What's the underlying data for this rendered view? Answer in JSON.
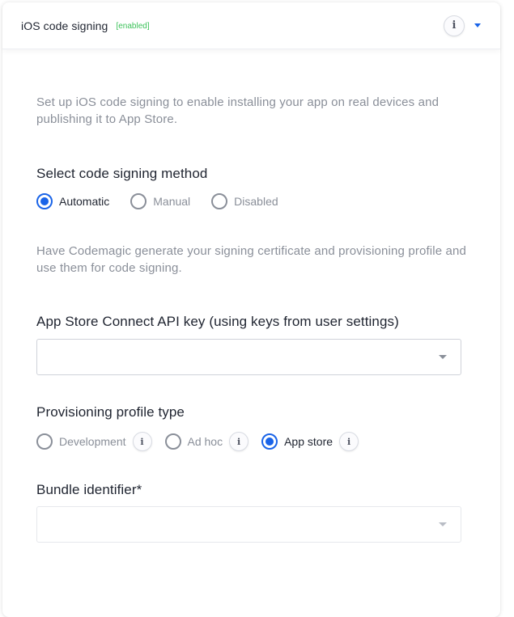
{
  "header": {
    "title": "iOS code signing",
    "badge": "[enabled]",
    "info_icon": "info-icon",
    "toggle_icon": "caret-down-icon"
  },
  "description": "Set up iOS code signing to enable installing your app on real devices and publishing it to App Store.",
  "signing_method": {
    "label": "Select code signing method",
    "options": [
      {
        "label": "Automatic",
        "selected": true
      },
      {
        "label": "Manual",
        "selected": false
      },
      {
        "label": "Disabled",
        "selected": false
      }
    ]
  },
  "automatic_description": "Have Codemagic generate your signing certificate and provisioning profile and use them for code signing.",
  "api_key": {
    "label": "App Store Connect API key (using keys from user settings)",
    "value": ""
  },
  "provisioning": {
    "label": "Provisioning profile type",
    "options": [
      {
        "label": "Development",
        "selected": false
      },
      {
        "label": "Ad hoc",
        "selected": false
      },
      {
        "label": "App store",
        "selected": true
      }
    ],
    "info_glyph": "i"
  },
  "bundle": {
    "label": "Bundle identifier",
    "required_mark": "*",
    "value": ""
  },
  "colors": {
    "accent": "#1a64e8",
    "badge_green": "#3cc25a",
    "muted_text": "#8a8f99"
  }
}
